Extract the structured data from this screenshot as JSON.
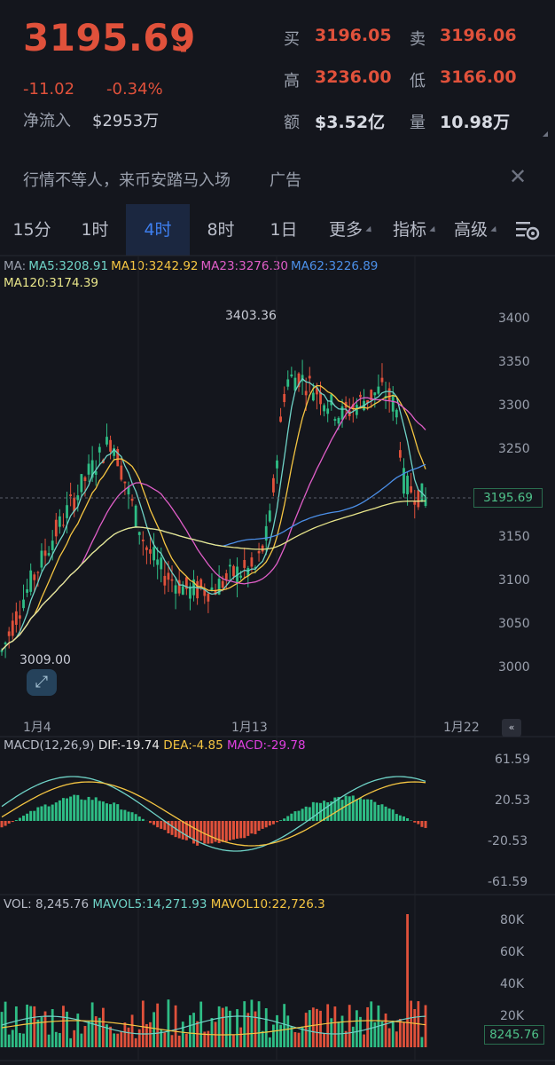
{
  "header": {
    "last_price": "3195.69",
    "arrow": "↘",
    "change_abs": "-11.02",
    "change_pct": "-0.34%",
    "net_inflow_label": "净流入",
    "net_inflow_value": "$2953万",
    "stats": {
      "bid_label": "买",
      "bid_value": "3196.05",
      "ask_label": "卖",
      "ask_value": "3196.06",
      "high_label": "高",
      "high_value": "3236.00",
      "low_label": "低",
      "low_value": "3166.00",
      "amount_label": "额",
      "amount_value": "$3.52亿",
      "volume_label": "量",
      "volume_value": "10.98万"
    }
  },
  "ad": {
    "text": "行情不等人，来币安踏马入场",
    "tag": "广告",
    "close": "✕"
  },
  "tabs": [
    {
      "label": "15分"
    },
    {
      "label": "1时"
    },
    {
      "label": "4时"
    },
    {
      "label": "8时"
    },
    {
      "label": "1日"
    },
    {
      "label": "更多"
    },
    {
      "label": "指标"
    },
    {
      "label": "高级"
    }
  ],
  "active_tab": "4时",
  "ma_legend": {
    "prefix": "MA:",
    "ma5": "MA5:3208.91",
    "ma10": "MA10:3242.92",
    "ma23": "MA23:3276.30",
    "ma62": "MA62:3226.89",
    "ma120": "MA120:3174.39"
  },
  "price_axis": [
    "3400",
    "3350",
    "3300",
    "3250",
    "3150",
    "3100",
    "3050",
    "3000"
  ],
  "current_price_tag": "3195.69",
  "high_marker": "3403.36",
  "low_marker": "3009.00",
  "dates": [
    "1月4",
    "1月13",
    "1月22"
  ],
  "collapse_glyph": "«",
  "expand_glyph": "⤢",
  "macd": {
    "title": "MACD(12,26,9)",
    "dif": "DIF:-19.74",
    "dea": "DEA:-4.85",
    "macd": "MACD:-29.78",
    "axis": [
      "61.59",
      "20.53",
      "-20.53",
      "-61.59"
    ]
  },
  "vol": {
    "vol": "VOL: 8,245.76",
    "mavol5": "MAVOL5:14,271.93",
    "mavol10": "MAVOL10:22,726.3",
    "axis": [
      "80K",
      "60K",
      "40K",
      "20K"
    ],
    "tag": "8245.76"
  },
  "colors": {
    "up": "#2ebd85",
    "down": "#e0513b",
    "ma5": "#6fd3c7",
    "ma10": "#f5c542",
    "ma23": "#e05ec8",
    "ma62": "#4b8fe8",
    "ma120": "#e8e58a",
    "active_tab": "#3e7ff0"
  }
}
